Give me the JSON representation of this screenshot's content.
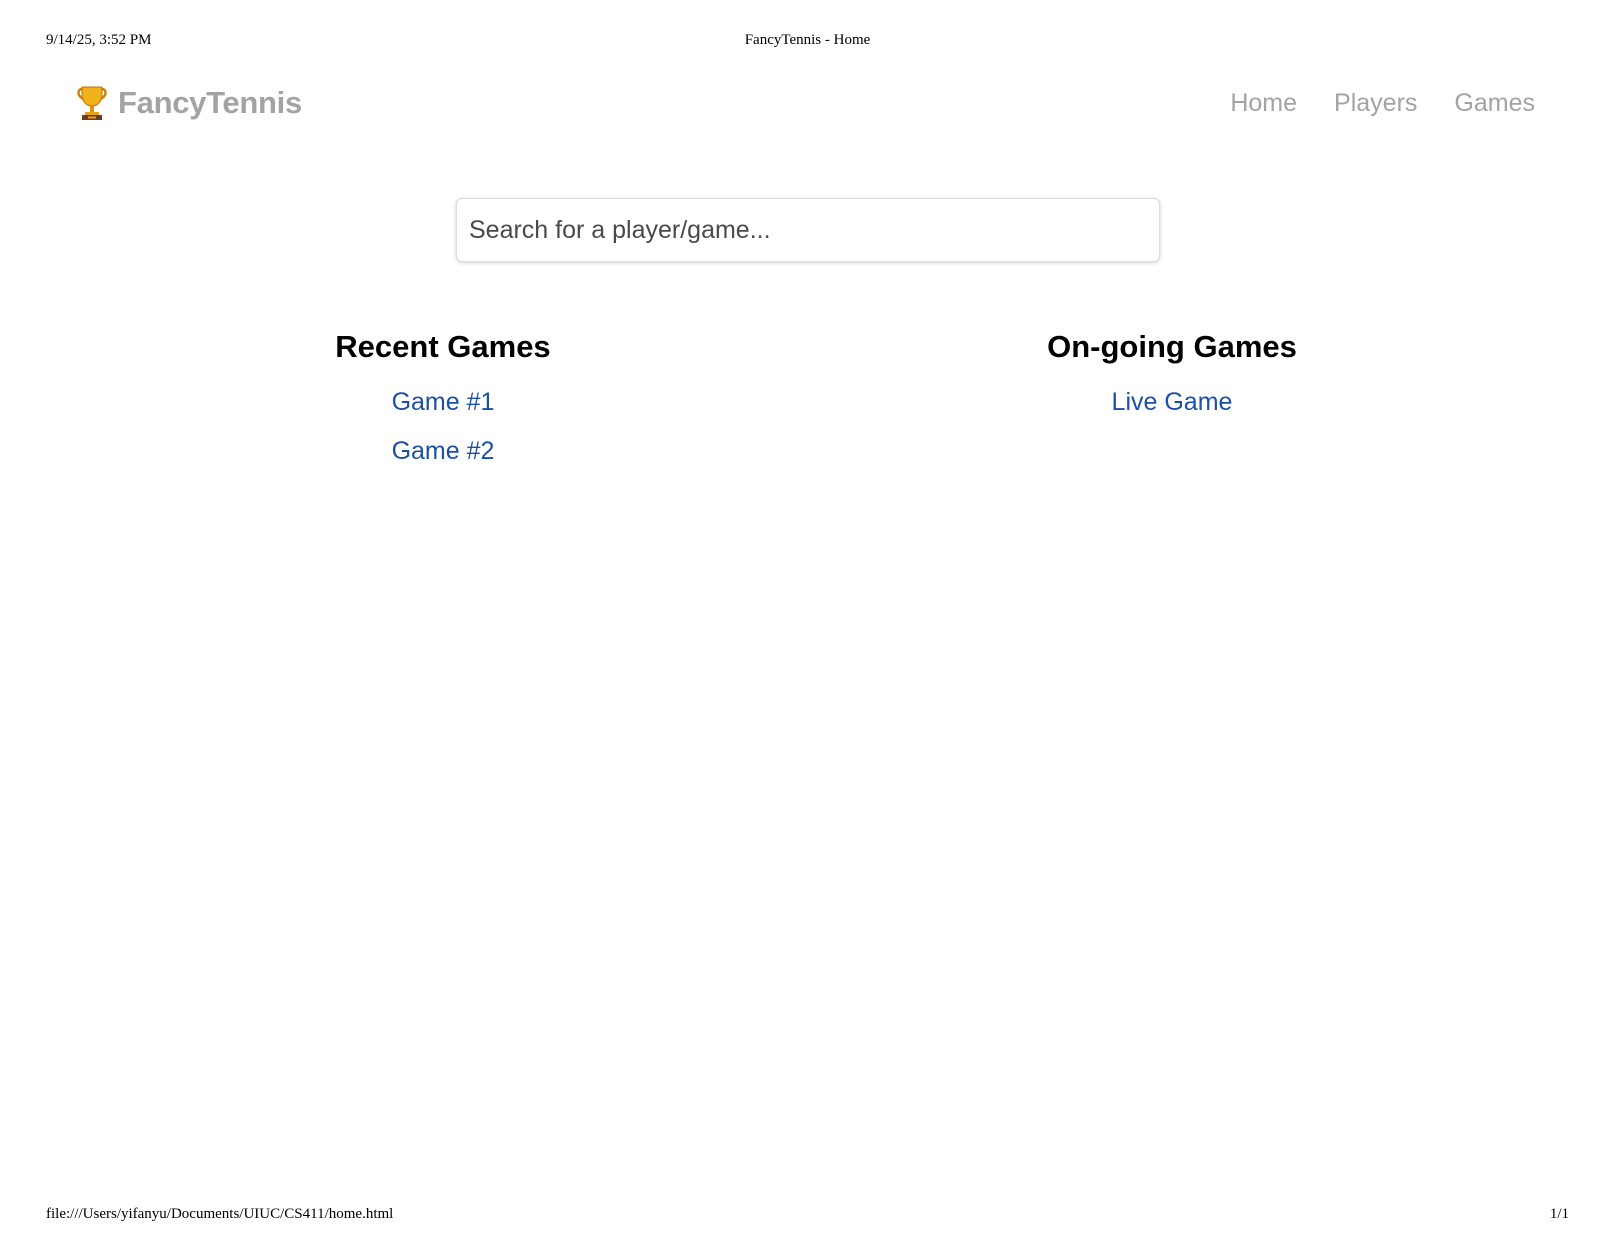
{
  "print_header": {
    "datetime": "9/14/25, 3:52 PM",
    "title": "FancyTennis - Home"
  },
  "print_footer": {
    "url": "file:///Users/yifanyu/Documents/UIUC/CS411/home.html",
    "page": "1/1"
  },
  "navbar": {
    "brand_icon": "trophy-icon",
    "brand": "FancyTennis",
    "links": [
      "Home",
      "Players",
      "Games"
    ]
  },
  "search": {
    "placeholder": "Search for a player/game..."
  },
  "recent_games": {
    "heading": "Recent Games",
    "items": [
      "Game #1",
      "Game #2"
    ]
  },
  "ongoing_games": {
    "heading": "On-going Games",
    "items": [
      "Live Game"
    ]
  },
  "colors": {
    "link": "#1c4fa6",
    "nav_muted": "#a3a3a3",
    "heading": "#000000"
  }
}
